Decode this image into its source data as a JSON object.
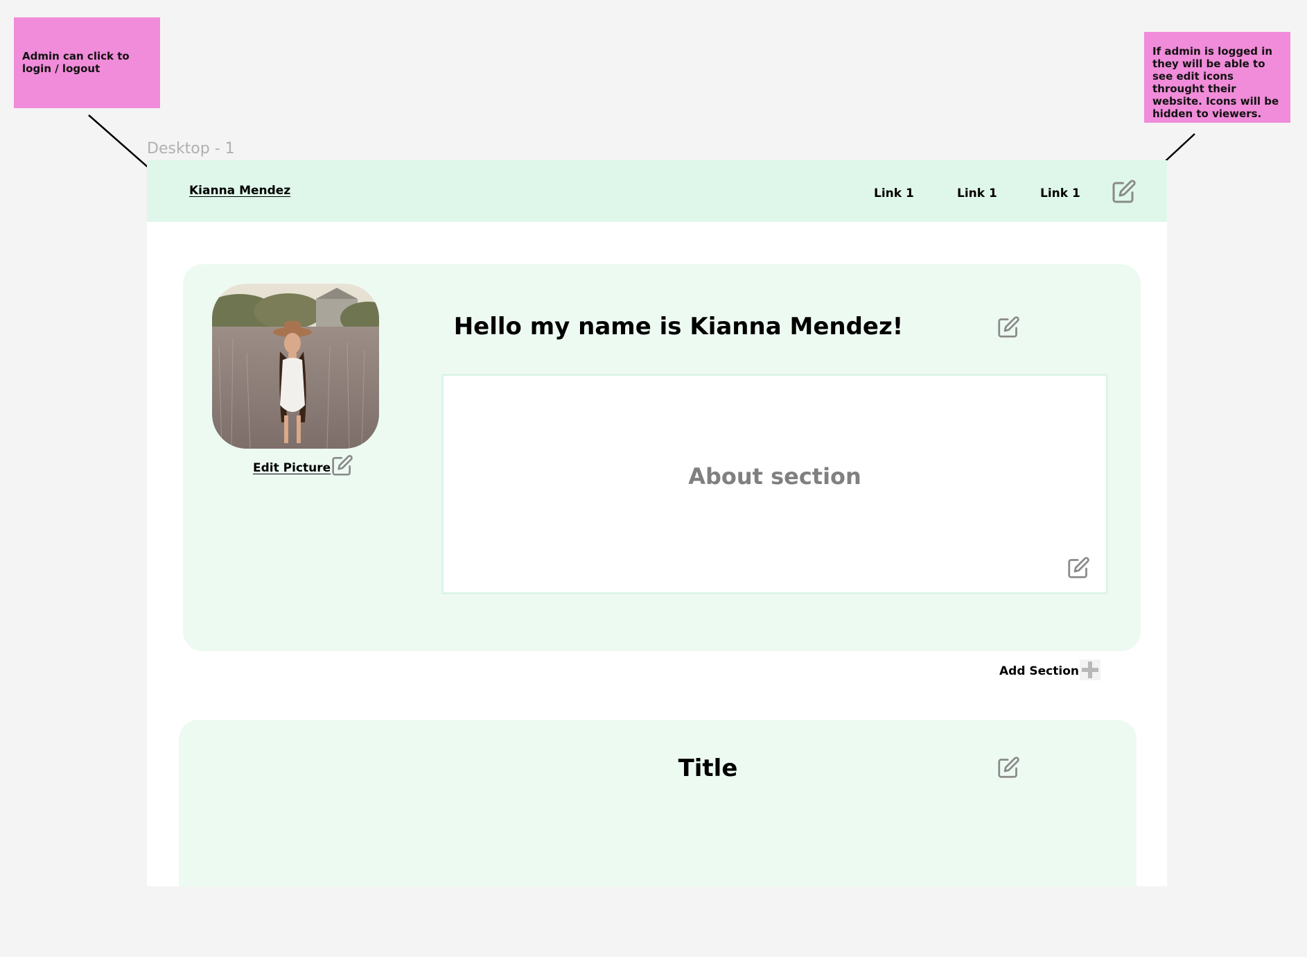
{
  "annotations": {
    "left_note": "Admin can click to login / logout",
    "right_note": "If admin is logged in they will be able to see edit icons throught their website. Icons will be hidden to viewers."
  },
  "frame": {
    "label": "Desktop - 1"
  },
  "navbar": {
    "brand": "Kianna Mendez",
    "links": [
      "Link 1",
      "Link 1",
      "Link 1"
    ]
  },
  "profile": {
    "edit_picture_label": "Edit Picture",
    "heading": "Hello my name is Kianna Mendez!",
    "about_text": "About section"
  },
  "add_section": {
    "label": "Add Section"
  },
  "section2": {
    "title": "Title"
  },
  "colors": {
    "sticky": "#f08cd9",
    "navbar_bg": "#dff7ea",
    "card_bg": "#edfaf2",
    "icon_gray": "#8a8a8a"
  }
}
